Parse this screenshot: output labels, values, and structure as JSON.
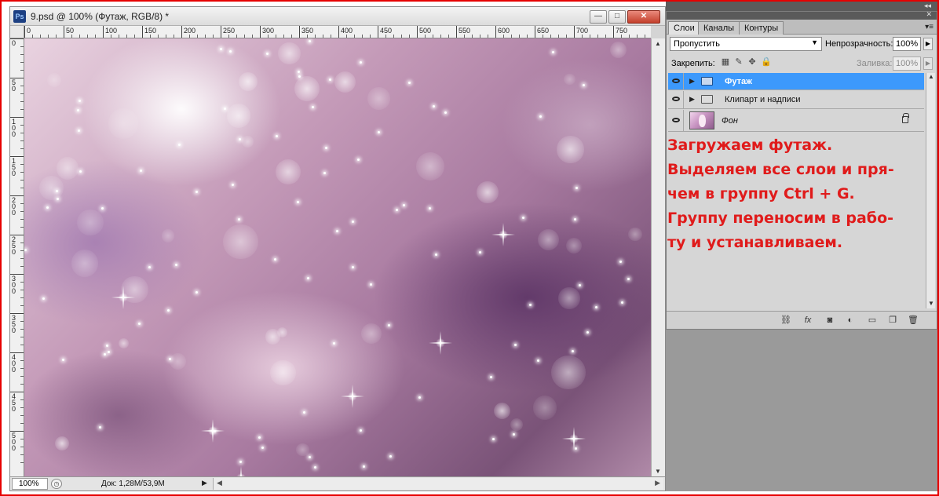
{
  "document": {
    "title": "9.psd @ 100% (Футаж, RGB/8) *",
    "app_icon": "Ps",
    "window_buttons": {
      "minimize": "—",
      "maximize": "□",
      "close": "✕"
    },
    "ruler_h_labels": [
      "0",
      "50",
      "100",
      "150",
      "200",
      "250",
      "300",
      "350",
      "400",
      "450",
      "500",
      "550",
      "600",
      "650",
      "700",
      "750"
    ],
    "ruler_v_labels": [
      "0",
      "50",
      "100",
      "150",
      "200",
      "250",
      "300",
      "350",
      "400",
      "450",
      "500"
    ],
    "status": {
      "zoom": "100%",
      "doc_info": "Док: 1,28M/53,9M",
      "arrow": "▶"
    }
  },
  "panel": {
    "collapse_glyph": "◂◂",
    "close_glyph": "✕",
    "tabs": [
      {
        "label": "Слои",
        "active": true
      },
      {
        "label": "Каналы",
        "active": false
      },
      {
        "label": "Контуры",
        "active": false
      }
    ],
    "menu_glyph": "▾≡",
    "blend_mode": "Пропустить",
    "opacity_label": "Непрозрачность:",
    "opacity_value": "100%",
    "lock_label": "Закрепить:",
    "fill_label": "Заливка:",
    "fill_value": "100%",
    "layers": [
      {
        "name": "Футаж",
        "type": "group",
        "selected": true,
        "visible": true
      },
      {
        "name": "Клипарт и надписи",
        "type": "group",
        "selected": false,
        "visible": true
      },
      {
        "name": "Фон",
        "type": "layer",
        "selected": false,
        "visible": true,
        "locked": true
      }
    ],
    "bottom_icons": [
      "link-icon",
      "fx-icon",
      "mask-icon",
      "adjustment-icon",
      "new-group-icon",
      "new-layer-icon",
      "trash-icon"
    ]
  },
  "annotation": {
    "text": "Загружаем футаж.\nВыделяем все слои и пря-\nчем в группу Ctrl + G.\nГруппу переносим в рабо-\nту и устанавливаем."
  },
  "colors": {
    "selection": "#3c99fc",
    "annotation": "#e01b1b",
    "frame": "#e60000"
  }
}
